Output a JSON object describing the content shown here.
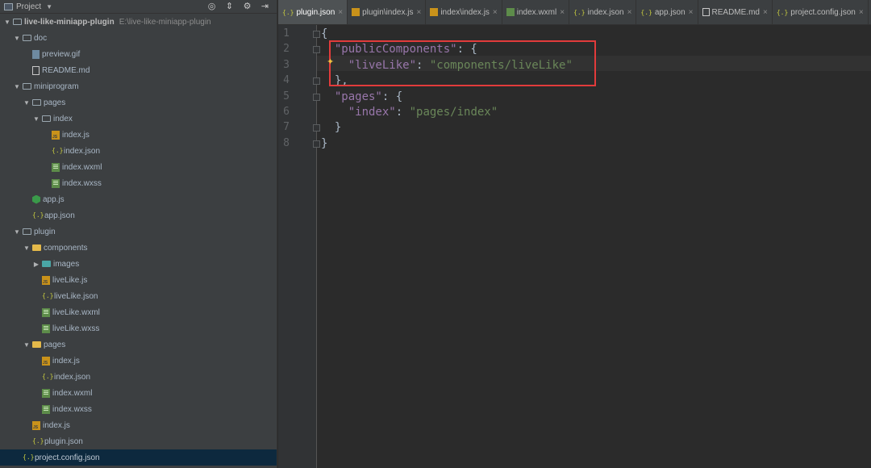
{
  "project_panel": {
    "title": "Project",
    "root_name": "live-like-miniapp-plugin",
    "root_path": "E:\\live-like-miniapp-plugin",
    "tree": [
      {
        "label": "doc",
        "depth": 1,
        "kind": "folder",
        "expanded": true
      },
      {
        "label": "preview.gif",
        "depth": 2,
        "kind": "gif"
      },
      {
        "label": "README.md",
        "depth": 2,
        "kind": "md"
      },
      {
        "label": "miniprogram",
        "depth": 1,
        "kind": "folder",
        "expanded": true
      },
      {
        "label": "pages",
        "depth": 2,
        "kind": "folder",
        "expanded": true
      },
      {
        "label": "index",
        "depth": 3,
        "kind": "folder",
        "expanded": true
      },
      {
        "label": "index.js",
        "depth": 4,
        "kind": "js"
      },
      {
        "label": "index.json",
        "depth": 4,
        "kind": "json"
      },
      {
        "label": "index.wxml",
        "depth": 4,
        "kind": "wx"
      },
      {
        "label": "index.wxss",
        "depth": 4,
        "kind": "wx"
      },
      {
        "label": "app.js",
        "depth": 2,
        "kind": "appjs"
      },
      {
        "label": "app.json",
        "depth": 2,
        "kind": "json"
      },
      {
        "label": "plugin",
        "depth": 1,
        "kind": "folder",
        "expanded": true
      },
      {
        "label": "components",
        "depth": 2,
        "kind": "folder-yellow",
        "expanded": true
      },
      {
        "label": "images",
        "depth": 3,
        "kind": "folder-teal",
        "expanded": false
      },
      {
        "label": "liveLike.js",
        "depth": 3,
        "kind": "js"
      },
      {
        "label": "liveLike.json",
        "depth": 3,
        "kind": "json"
      },
      {
        "label": "liveLike.wxml",
        "depth": 3,
        "kind": "wx"
      },
      {
        "label": "liveLike.wxss",
        "depth": 3,
        "kind": "wx"
      },
      {
        "label": "pages",
        "depth": 2,
        "kind": "folder-yellow",
        "expanded": true
      },
      {
        "label": "index.js",
        "depth": 3,
        "kind": "js"
      },
      {
        "label": "index.json",
        "depth": 3,
        "kind": "json"
      },
      {
        "label": "index.wxml",
        "depth": 3,
        "kind": "wx"
      },
      {
        "label": "index.wxss",
        "depth": 3,
        "kind": "wx"
      },
      {
        "label": "index.js",
        "depth": 2,
        "kind": "js"
      },
      {
        "label": "plugin.json",
        "depth": 2,
        "kind": "json"
      },
      {
        "label": "project.config.json",
        "depth": 1,
        "kind": "json",
        "selected": true
      }
    ]
  },
  "tabs": [
    {
      "label": "plugin.json",
      "kind": "json",
      "active": true
    },
    {
      "label": "plugin\\index.js",
      "kind": "js"
    },
    {
      "label": "index\\index.js",
      "kind": "js"
    },
    {
      "label": "index.wxml",
      "kind": "wx"
    },
    {
      "label": "index.json",
      "kind": "json"
    },
    {
      "label": "app.json",
      "kind": "json"
    },
    {
      "label": "README.md",
      "kind": "md"
    },
    {
      "label": "project.config.json",
      "kind": "json"
    }
  ],
  "editor": {
    "line_numbers": [
      "1",
      "2",
      "3",
      "4",
      "5",
      "6",
      "7",
      "8"
    ],
    "lines": [
      [
        {
          "t": "{",
          "c": "pl"
        }
      ],
      [
        {
          "t": "  ",
          "c": "pl"
        },
        {
          "t": "\"publicComponents\"",
          "c": "key"
        },
        {
          "t": ": {",
          "c": "pl"
        }
      ],
      [
        {
          "t": "    ",
          "c": "pl"
        },
        {
          "t": "\"liveLike\"",
          "c": "key"
        },
        {
          "t": ": ",
          "c": "pl"
        },
        {
          "t": "\"components/liveLike\"",
          "c": "str"
        }
      ],
      [
        {
          "t": "  },",
          "c": "pl"
        }
      ],
      [
        {
          "t": "  ",
          "c": "pl"
        },
        {
          "t": "\"pages\"",
          "c": "key"
        },
        {
          "t": ": {",
          "c": "pl"
        }
      ],
      [
        {
          "t": "    ",
          "c": "pl"
        },
        {
          "t": "\"index\"",
          "c": "key"
        },
        {
          "t": ": ",
          "c": "pl"
        },
        {
          "t": "\"pages/index\"",
          "c": "str"
        }
      ],
      [
        {
          "t": "  }",
          "c": "pl"
        }
      ],
      [
        {
          "t": "}",
          "c": "pl"
        }
      ]
    ]
  },
  "colors": {
    "highlight_box": "#e23b3b",
    "json_key": "#9876aa",
    "json_string": "#6a8759"
  }
}
